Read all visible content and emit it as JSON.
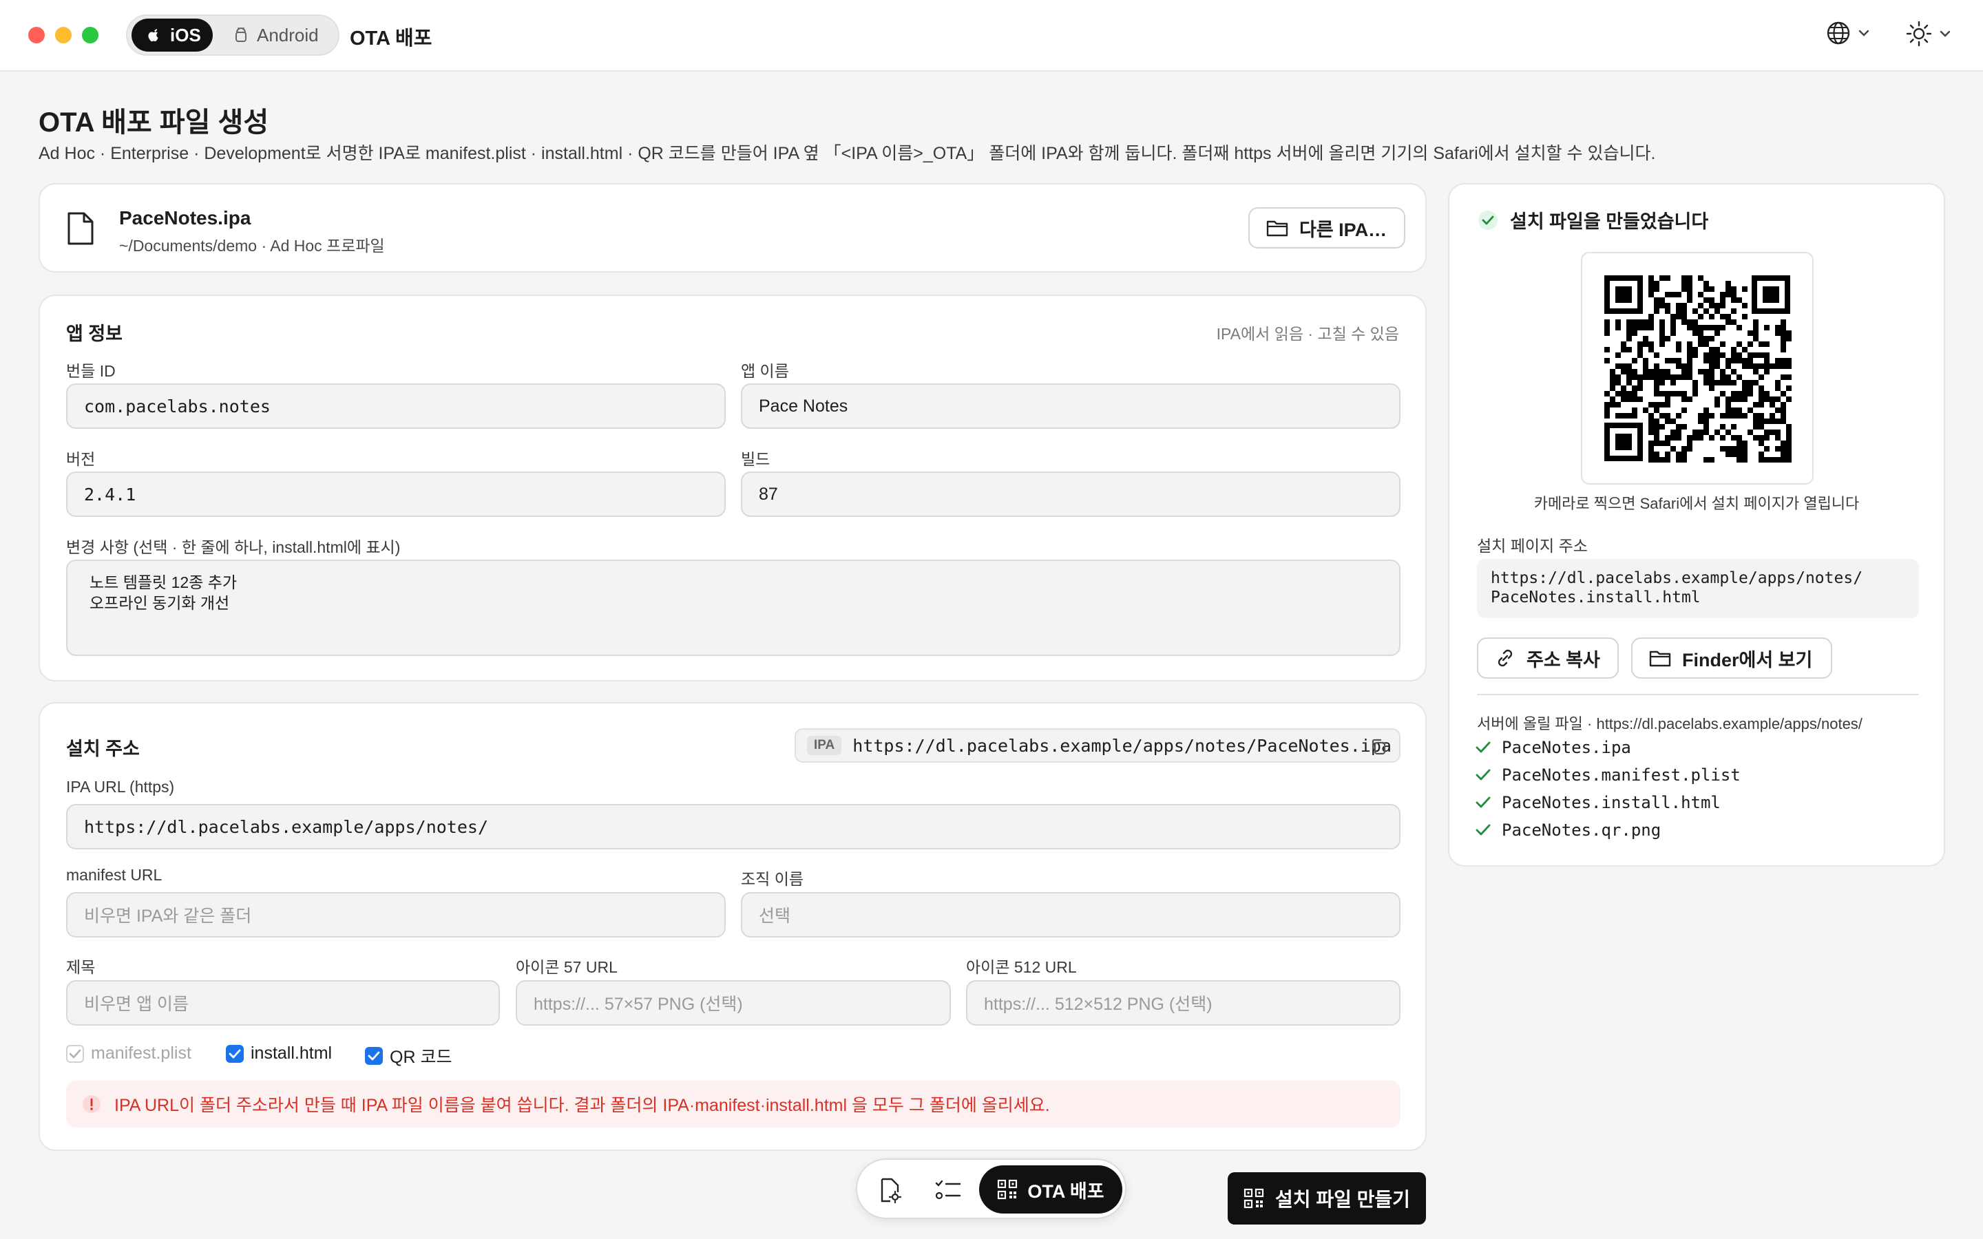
{
  "titlebar": {
    "platform_ios": "iOS",
    "platform_android": "Android",
    "app_title": "OTA 배포"
  },
  "page": {
    "title": "OTA 배포 파일 생성",
    "subtitle": "Ad Hoc · Enterprise · Development로 서명한 IPA로 manifest.plist · install.html · QR 코드를 만들어 IPA 옆 「<IPA 이름>_OTA」 폴더에 IPA와 함께 둡니다. 폴더째 https 서버에 올리면 기기의 Safari에서 설치할 수 있습니다."
  },
  "file": {
    "name": "PaceNotes.ipa",
    "meta": "~/Documents/demo · Ad Hoc 프로파일",
    "other_button": "다른 IPA…"
  },
  "app_info": {
    "title": "앱 정보",
    "hint": "IPA에서 읽음 · 고칠 수 있음",
    "bundle_label": "번들 ID",
    "bundle_value": "com.pacelabs.notes",
    "name_label": "앱 이름",
    "name_value": "Pace Notes",
    "version_label": "버전",
    "version_value": "2.4.1",
    "build_label": "빌드",
    "build_value": "87",
    "changes_label": "변경 사항 (선택 · 한 줄에 하나, install.html에 표시)",
    "changes_line1": "노트 템플릿 12종 추가",
    "changes_line2": "오프라인 동기화 개선"
  },
  "install": {
    "title": "설치 주소",
    "ipa_tag": "IPA",
    "ipa_full_url": "https://dl.pacelabs.example/apps/notes/PaceNotes.ipa",
    "ipa_url_label": "IPA URL (https)",
    "ipa_url_value": "https://dl.pacelabs.example/apps/notes/",
    "manifest_label": "manifest URL",
    "manifest_placeholder": "비우면 IPA와 같은 폴더",
    "org_label": "조직 이름",
    "org_placeholder": "선택",
    "title_label": "제목",
    "title_placeholder": "비우면 앱 이름",
    "icon57_label": "아이콘 57 URL",
    "icon57_placeholder": "https://... 57×57 PNG (선택)",
    "icon512_label": "아이콘 512 URL",
    "icon512_placeholder": "https://... 512×512 PNG (선택)",
    "opt_manifest": "manifest.plist",
    "opt_install": "install.html",
    "opt_qr": "QR 코드",
    "warning": "IPA URL이 폴더 주소라서 만들 때 IPA 파일 이름을 붙여 씁니다. 결과 폴더의 IPA·manifest·install.html 을 모두 그 폴더에 올리세요."
  },
  "result": {
    "title": "설치 파일을 만들었습니다",
    "qr_caption": "카메라로 찍으면 Safari에서 설치 페이지가 열립니다",
    "url_label": "설치 페이지 주소",
    "url_line1": "https://dl.pacelabs.example/apps/notes/",
    "url_line2": "PaceNotes.install.html",
    "copy_button": "주소 복사",
    "finder_button": "Finder에서 보기",
    "upload_label": "서버에 올릴 파일 · https://dl.pacelabs.example/apps/notes/",
    "files": [
      "PaceNotes.ipa",
      "PaceNotes.manifest.plist",
      "PaceNotes.install.html",
      "PaceNotes.qr.png"
    ]
  },
  "dock": {
    "active_label": "OTA 배포"
  },
  "primary_button": "설치 파일 만들기"
}
